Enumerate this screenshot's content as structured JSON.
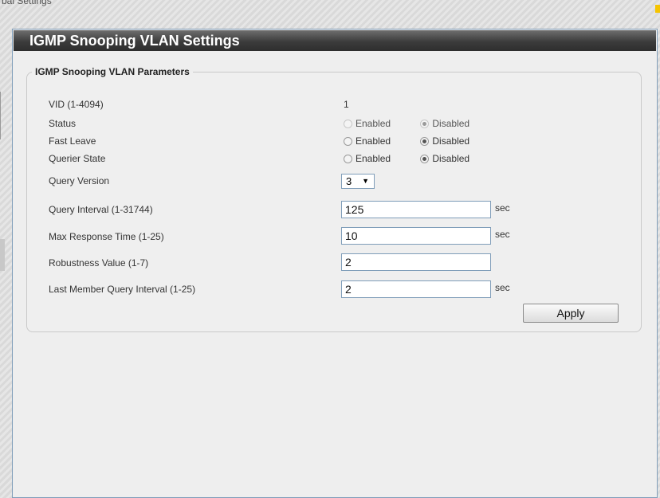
{
  "background": {
    "title": "bal Settings"
  },
  "dialog": {
    "title": "IGMP Snooping VLAN Settings",
    "fieldset_legend": "IGMP Snooping VLAN Parameters",
    "vid": {
      "label": "VID (1-4094)",
      "value": "1"
    },
    "status": {
      "label": "Status",
      "enabled": "Enabled",
      "disabled": "Disabled",
      "selected": "Disabled"
    },
    "fast_leave": {
      "label": "Fast Leave",
      "enabled": "Enabled",
      "disabled": "Disabled",
      "selected": "Disabled"
    },
    "querier_state": {
      "label": "Querier State",
      "enabled": "Enabled",
      "disabled": "Disabled",
      "selected": "Disabled"
    },
    "query_version": {
      "label": "Query Version",
      "value": "3"
    },
    "query_interval": {
      "label": "Query Interval (1-31744)",
      "value": "125",
      "unit": "sec"
    },
    "max_response_time": {
      "label": "Max Response Time (1-25)",
      "value": "10",
      "unit": "sec"
    },
    "robustness_value": {
      "label": "Robustness Value (1-7)",
      "value": "2"
    },
    "last_member_query_interval": {
      "label": "Last Member Query Interval (1-25)",
      "value": "2",
      "unit": "sec"
    },
    "apply_label": "Apply"
  },
  "colors": {
    "titlebar": "#3c3c3c",
    "dialog_bg": "#eeeeee",
    "input_border": "#7f9db9"
  }
}
